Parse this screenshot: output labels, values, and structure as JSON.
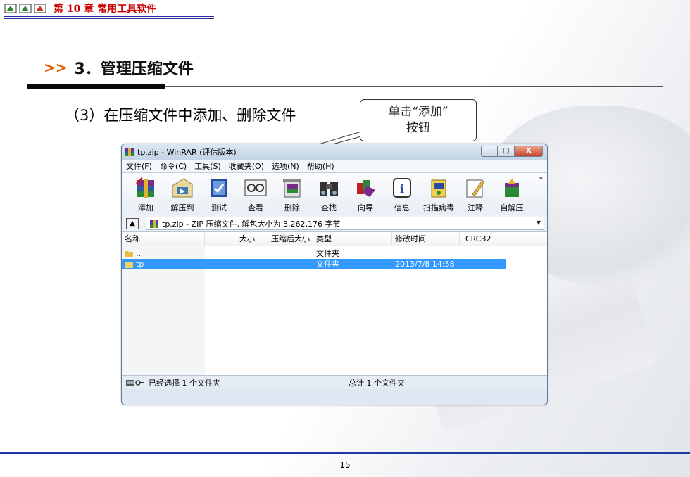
{
  "header": {
    "chapter": "第 10 章   常用工具软件",
    "title_prefix": ">>",
    "title": "3．管理压缩文件",
    "subtitle": "（3）在压缩文件中添加、删除文件"
  },
  "callout": {
    "line1": "单击“添加”",
    "line2": "按钮"
  },
  "window": {
    "title": "tp.zip - WinRAR (评估版本)",
    "controls": {
      "minimize": "—",
      "maximize": "□",
      "close": "X"
    },
    "menu": [
      "文件(F)",
      "命令(C)",
      "工具(S)",
      "收藏夹(O)",
      "选项(N)",
      "帮助(H)"
    ],
    "toolbar": [
      {
        "label": "添加",
        "icon": "add-archive-icon"
      },
      {
        "label": "解压到",
        "icon": "extract-to-icon"
      },
      {
        "label": "测试",
        "icon": "test-icon"
      },
      {
        "label": "查看",
        "icon": "view-icon"
      },
      {
        "label": "删除",
        "icon": "delete-icon"
      },
      {
        "label": "查找",
        "icon": "find-icon"
      },
      {
        "label": "向导",
        "icon": "wizard-icon"
      },
      {
        "label": "信息",
        "icon": "info-icon"
      },
      {
        "label": "扫描病毒",
        "icon": "scan-virus-icon"
      },
      {
        "label": "注释",
        "icon": "comment-icon"
      },
      {
        "label": "自解压",
        "icon": "sfx-icon"
      }
    ],
    "toolbar_more": "»",
    "address": "tp.zip - ZIP 压缩文件, 解包大小为 3,262,176 字节",
    "columns": [
      "名称",
      "大小",
      "压缩后大小",
      "类型",
      "修改时间",
      "CRC32"
    ],
    "rows": [
      {
        "name": "..",
        "size": "",
        "packed": "",
        "type": "文件夹",
        "modified": "",
        "selected": false
      },
      {
        "name": "tp",
        "size": "",
        "packed": "",
        "type": "文件夹",
        "modified": "2013/7/8 14:58",
        "selected": true
      }
    ],
    "status_left": "已经选择 1 个文件夹",
    "status_right": "总计 1 个文件夹"
  },
  "footer": {
    "page": "15"
  },
  "colors": {
    "accent_red": "#cc0000",
    "arrow_orange": "#e06000",
    "footer_blue": "#1e3aa0",
    "selection_blue": "#3399ff"
  }
}
